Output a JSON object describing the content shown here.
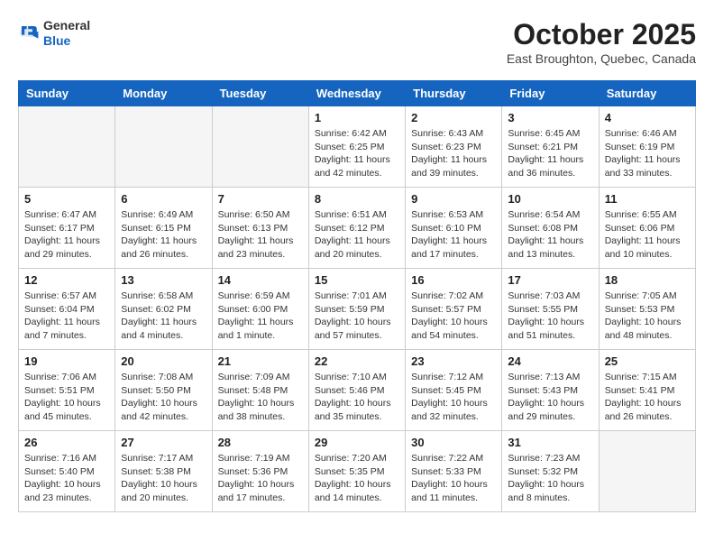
{
  "header": {
    "logo_line1": "General",
    "logo_line2": "Blue",
    "title": "October 2025",
    "subtitle": "East Broughton, Quebec, Canada"
  },
  "weekdays": [
    "Sunday",
    "Monday",
    "Tuesday",
    "Wednesday",
    "Thursday",
    "Friday",
    "Saturday"
  ],
  "weeks": [
    [
      {
        "day": "",
        "info": ""
      },
      {
        "day": "",
        "info": ""
      },
      {
        "day": "",
        "info": ""
      },
      {
        "day": "1",
        "info": "Sunrise: 6:42 AM\nSunset: 6:25 PM\nDaylight: 11 hours\nand 42 minutes."
      },
      {
        "day": "2",
        "info": "Sunrise: 6:43 AM\nSunset: 6:23 PM\nDaylight: 11 hours\nand 39 minutes."
      },
      {
        "day": "3",
        "info": "Sunrise: 6:45 AM\nSunset: 6:21 PM\nDaylight: 11 hours\nand 36 minutes."
      },
      {
        "day": "4",
        "info": "Sunrise: 6:46 AM\nSunset: 6:19 PM\nDaylight: 11 hours\nand 33 minutes."
      }
    ],
    [
      {
        "day": "5",
        "info": "Sunrise: 6:47 AM\nSunset: 6:17 PM\nDaylight: 11 hours\nand 29 minutes."
      },
      {
        "day": "6",
        "info": "Sunrise: 6:49 AM\nSunset: 6:15 PM\nDaylight: 11 hours\nand 26 minutes."
      },
      {
        "day": "7",
        "info": "Sunrise: 6:50 AM\nSunset: 6:13 PM\nDaylight: 11 hours\nand 23 minutes."
      },
      {
        "day": "8",
        "info": "Sunrise: 6:51 AM\nSunset: 6:12 PM\nDaylight: 11 hours\nand 20 minutes."
      },
      {
        "day": "9",
        "info": "Sunrise: 6:53 AM\nSunset: 6:10 PM\nDaylight: 11 hours\nand 17 minutes."
      },
      {
        "day": "10",
        "info": "Sunrise: 6:54 AM\nSunset: 6:08 PM\nDaylight: 11 hours\nand 13 minutes."
      },
      {
        "day": "11",
        "info": "Sunrise: 6:55 AM\nSunset: 6:06 PM\nDaylight: 11 hours\nand 10 minutes."
      }
    ],
    [
      {
        "day": "12",
        "info": "Sunrise: 6:57 AM\nSunset: 6:04 PM\nDaylight: 11 hours\nand 7 minutes."
      },
      {
        "day": "13",
        "info": "Sunrise: 6:58 AM\nSunset: 6:02 PM\nDaylight: 11 hours\nand 4 minutes."
      },
      {
        "day": "14",
        "info": "Sunrise: 6:59 AM\nSunset: 6:00 PM\nDaylight: 11 hours\nand 1 minute."
      },
      {
        "day": "15",
        "info": "Sunrise: 7:01 AM\nSunset: 5:59 PM\nDaylight: 10 hours\nand 57 minutes."
      },
      {
        "day": "16",
        "info": "Sunrise: 7:02 AM\nSunset: 5:57 PM\nDaylight: 10 hours\nand 54 minutes."
      },
      {
        "day": "17",
        "info": "Sunrise: 7:03 AM\nSunset: 5:55 PM\nDaylight: 10 hours\nand 51 minutes."
      },
      {
        "day": "18",
        "info": "Sunrise: 7:05 AM\nSunset: 5:53 PM\nDaylight: 10 hours\nand 48 minutes."
      }
    ],
    [
      {
        "day": "19",
        "info": "Sunrise: 7:06 AM\nSunset: 5:51 PM\nDaylight: 10 hours\nand 45 minutes."
      },
      {
        "day": "20",
        "info": "Sunrise: 7:08 AM\nSunset: 5:50 PM\nDaylight: 10 hours\nand 42 minutes."
      },
      {
        "day": "21",
        "info": "Sunrise: 7:09 AM\nSunset: 5:48 PM\nDaylight: 10 hours\nand 38 minutes."
      },
      {
        "day": "22",
        "info": "Sunrise: 7:10 AM\nSunset: 5:46 PM\nDaylight: 10 hours\nand 35 minutes."
      },
      {
        "day": "23",
        "info": "Sunrise: 7:12 AM\nSunset: 5:45 PM\nDaylight: 10 hours\nand 32 minutes."
      },
      {
        "day": "24",
        "info": "Sunrise: 7:13 AM\nSunset: 5:43 PM\nDaylight: 10 hours\nand 29 minutes."
      },
      {
        "day": "25",
        "info": "Sunrise: 7:15 AM\nSunset: 5:41 PM\nDaylight: 10 hours\nand 26 minutes."
      }
    ],
    [
      {
        "day": "26",
        "info": "Sunrise: 7:16 AM\nSunset: 5:40 PM\nDaylight: 10 hours\nand 23 minutes."
      },
      {
        "day": "27",
        "info": "Sunrise: 7:17 AM\nSunset: 5:38 PM\nDaylight: 10 hours\nand 20 minutes."
      },
      {
        "day": "28",
        "info": "Sunrise: 7:19 AM\nSunset: 5:36 PM\nDaylight: 10 hours\nand 17 minutes."
      },
      {
        "day": "29",
        "info": "Sunrise: 7:20 AM\nSunset: 5:35 PM\nDaylight: 10 hours\nand 14 minutes."
      },
      {
        "day": "30",
        "info": "Sunrise: 7:22 AM\nSunset: 5:33 PM\nDaylight: 10 hours\nand 11 minutes."
      },
      {
        "day": "31",
        "info": "Sunrise: 7:23 AM\nSunset: 5:32 PM\nDaylight: 10 hours\nand 8 minutes."
      },
      {
        "day": "",
        "info": ""
      }
    ]
  ]
}
